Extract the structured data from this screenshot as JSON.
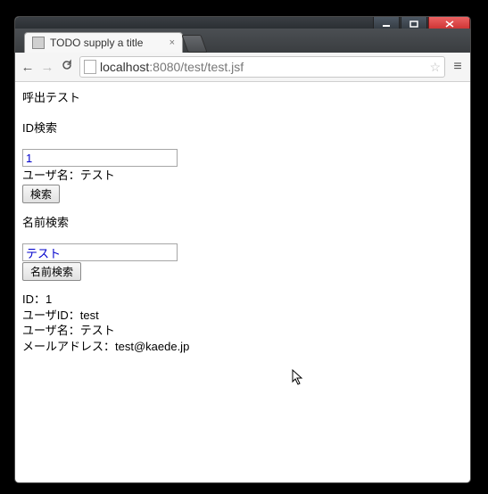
{
  "window": {
    "min_tip": "Minimize",
    "max_tip": "Maximize",
    "close_tip": "Close"
  },
  "browser": {
    "tab_title": "TODO supply a title",
    "tab_close": "×",
    "url_prefix": "localhost",
    "url_suffix": ":8080/test/test.jsf",
    "menu_glyph": "≡"
  },
  "page": {
    "heading": "呼出テスト",
    "id_search": {
      "label": "ID検索",
      "input_value": "1",
      "result_line": "ユーザ名：テスト",
      "button": "検索"
    },
    "name_search": {
      "label": "名前検索",
      "input_value": "テスト",
      "button": "名前検索"
    },
    "results": {
      "id_line": "ID：1",
      "user_id_line": "ユーザID：test",
      "user_name_line": "ユーザ名：テスト",
      "mail_line": "メールアドレス：test@kaede.jp"
    }
  }
}
